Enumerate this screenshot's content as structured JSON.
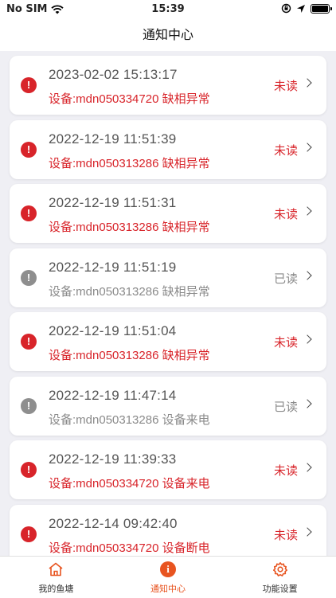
{
  "status_bar": {
    "carrier": "No SIM",
    "time": "15:39"
  },
  "header": {
    "title": "通知中心"
  },
  "notifications": [
    {
      "time": "2023-02-02 15:13:17",
      "desc": "设备:mdn050334720 缺相异常",
      "status": "未读",
      "read": false
    },
    {
      "time": "2022-12-19 11:51:39",
      "desc": "设备:mdn050313286 缺相异常",
      "status": "未读",
      "read": false
    },
    {
      "time": "2022-12-19 11:51:31",
      "desc": "设备:mdn050313286 缺相异常",
      "status": "未读",
      "read": false
    },
    {
      "time": "2022-12-19 11:51:19",
      "desc": "设备:mdn050313286 缺相异常",
      "status": "已读",
      "read": true
    },
    {
      "time": "2022-12-19 11:51:04",
      "desc": "设备:mdn050313286 缺相异常",
      "status": "未读",
      "read": false
    },
    {
      "time": "2022-12-19 11:47:14",
      "desc": "设备:mdn050313286 设备来电",
      "status": "已读",
      "read": true
    },
    {
      "time": "2022-12-19 11:39:33",
      "desc": "设备:mdn050334720 设备来电",
      "status": "未读",
      "read": false
    },
    {
      "time": "2022-12-14 09:42:40",
      "desc": "设备:mdn050334720 设备断电",
      "status": "未读",
      "read": false
    }
  ],
  "tabbar": {
    "tabs": [
      {
        "label": "我的鱼塘",
        "icon": "home-icon"
      },
      {
        "label": "通知中心",
        "icon": "info-icon"
      },
      {
        "label": "功能设置",
        "icon": "gear-icon"
      }
    ],
    "active_color": "#e85420"
  },
  "colors": {
    "unread": "#d8242a",
    "read": "#8a8a8a"
  }
}
